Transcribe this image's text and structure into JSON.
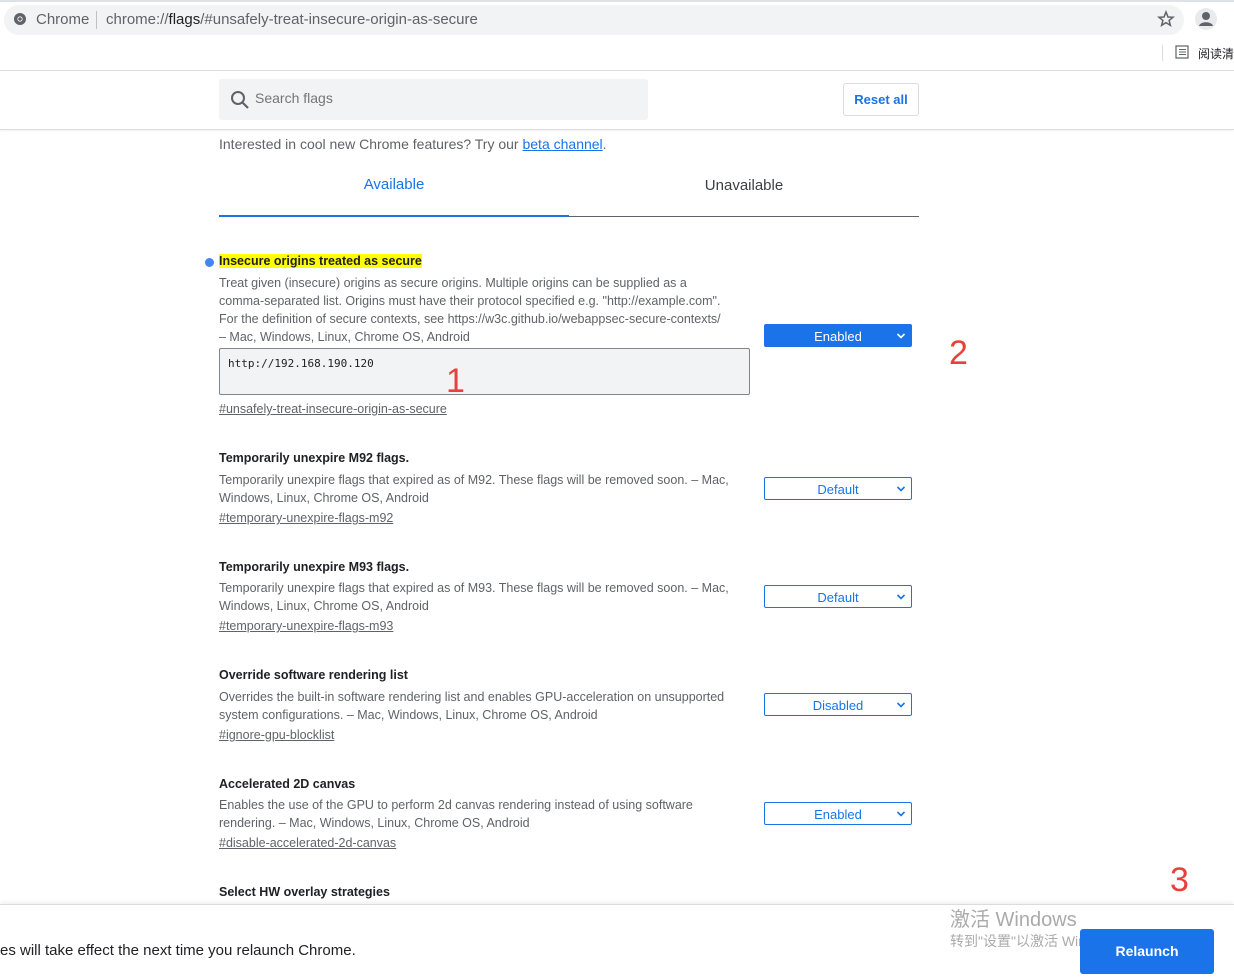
{
  "browser": {
    "site_name": "Chrome",
    "url_prefix": "chrome://",
    "url_host": "flags",
    "url_path": "/#unsafely-treat-insecure-origin-as-secure",
    "reading_mode_label": "阅读清"
  },
  "header": {
    "search_placeholder": "Search flags",
    "reset_label": "Reset all"
  },
  "intro": {
    "text": "Interested in cool new Chrome features? Try our ",
    "link": "beta channel",
    "suffix": "."
  },
  "tabs": {
    "available": "Available",
    "unavailable": "Unavailable"
  },
  "experiments": [
    {
      "title": "Insecure origins treated as secure",
      "desc1": "Treat given (insecure) origins as secure origins. Multiple origins can be supplied as a",
      "desc2": "comma-separated list. Origins must have their protocol specified e.g. \"http://example.com\".",
      "desc3": "For the definition of secure contexts, see https://w3c.github.io/webappsec-secure-contexts/",
      "desc4": "– Mac, Windows, Linux, Chrome OS, Android",
      "textarea_value": "http://192.168.190.120",
      "link": "#unsafely-treat-insecure-origin-as-secure",
      "state": "Enabled"
    },
    {
      "title": "Temporarily unexpire M92 flags.",
      "desc1": "Temporarily unexpire flags that expired as of M92. These flags will be removed soon. – Mac,",
      "desc2": "Windows, Linux, Chrome OS, Android",
      "link": "#temporary-unexpire-flags-m92",
      "state": "Default"
    },
    {
      "title": "Temporarily unexpire M93 flags.",
      "desc1": "Temporarily unexpire flags that expired as of M93. These flags will be removed soon. – Mac,",
      "desc2": "Windows, Linux, Chrome OS, Android",
      "link": "#temporary-unexpire-flags-m93",
      "state": "Default"
    },
    {
      "title": "Override software rendering list",
      "desc1": "Overrides the built-in software rendering list and enables GPU-acceleration on unsupported",
      "desc2": "system configurations. – Mac, Windows, Linux, Chrome OS, Android",
      "link": "#ignore-gpu-blocklist",
      "state": "Disabled"
    },
    {
      "title": "Accelerated 2D canvas",
      "desc1": "Enables the use of the GPU to perform 2d canvas rendering instead of using software",
      "desc2": "rendering. – Mac, Windows, Linux, Chrome OS, Android",
      "link": "#disable-accelerated-2d-canvas",
      "state": "Enabled"
    },
    {
      "title": "Select HW overlay strategies"
    }
  ],
  "annotations": [
    "1",
    "2",
    "3"
  ],
  "bottom": {
    "message": "es will take effect the next time you relaunch Chrome.",
    "relaunch_label": "Relaunch"
  },
  "watermark": {
    "line1": "激活 Windows",
    "line2": "转到\"设置\"以激活 Windows。"
  },
  "colors": {
    "accent": "#1a73e8",
    "highlight": "#ffff00",
    "annotation": "#e8413c"
  }
}
